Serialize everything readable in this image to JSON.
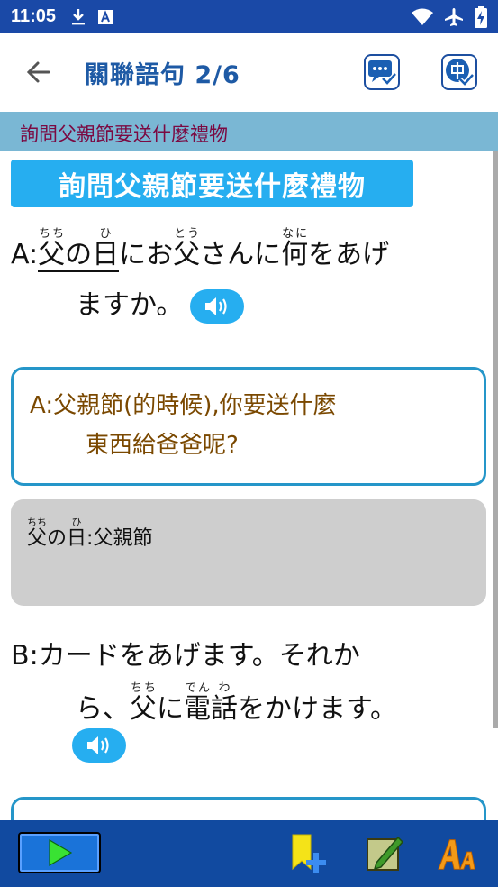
{
  "status_bar": {
    "time": "11:05"
  },
  "app_bar": {
    "title": "關聯語句 2/6"
  },
  "topic": {
    "label": "詢問父親節要送什麼禮物"
  },
  "content": {
    "title_chip": "詢問父親節要送什麼禮物",
    "sentence_a": {
      "speaker": "A:",
      "w1_base": "父",
      "w1_ruby": "ちち",
      "w2": "の",
      "w3_base": "日",
      "w3_ruby": "ひ",
      "w4": "にお",
      "w5_base": "父",
      "w5_ruby": "とう",
      "w6": "さんに",
      "w7_base": "何",
      "w7_ruby": "なに",
      "w8": "をあげ",
      "line2": "ますか。"
    },
    "translation_a": {
      "line1": "A:父親節(的時候),你要送什麼",
      "line2": "東西給爸爸呢?"
    },
    "vocab": {
      "w1_base": "父",
      "w1_ruby": "ちち",
      "w2": "の",
      "w3_base": "日",
      "w3_ruby": "ひ",
      "meaning": ":父親節"
    },
    "sentence_b": {
      "speaker": "B:",
      "line1": "カードをあげます。それか",
      "l2_a": "ら、",
      "l2_w1_base": "父",
      "l2_w1_ruby": "ちち",
      "l2_b": "に",
      "l2_w2_base": "電",
      "l2_w2_ruby": "でん",
      "l2_w3_base": "話",
      "l2_w3_ruby": "わ",
      "l2_c": "をかけます。"
    }
  },
  "colors": {
    "status_bar": "#1a49a7",
    "accent_blue": "#26aef0",
    "topic_strip": "#7ab7d4",
    "topic_text": "#7b0a42",
    "translation_text": "#7a4800",
    "bottom_bar": "#114aa0"
  },
  "icons": {
    "status": [
      "download-icon",
      "a-box-icon",
      "wifi-icon",
      "airplane-icon",
      "battery-charging-icon"
    ],
    "app_bar": [
      "back-arrow-icon",
      "chat-check-icon",
      "chinese-check-icon"
    ],
    "bottom_bar": [
      "play-icon",
      "bookmark-add-icon",
      "notes-icon",
      "font-size-icon"
    ]
  }
}
